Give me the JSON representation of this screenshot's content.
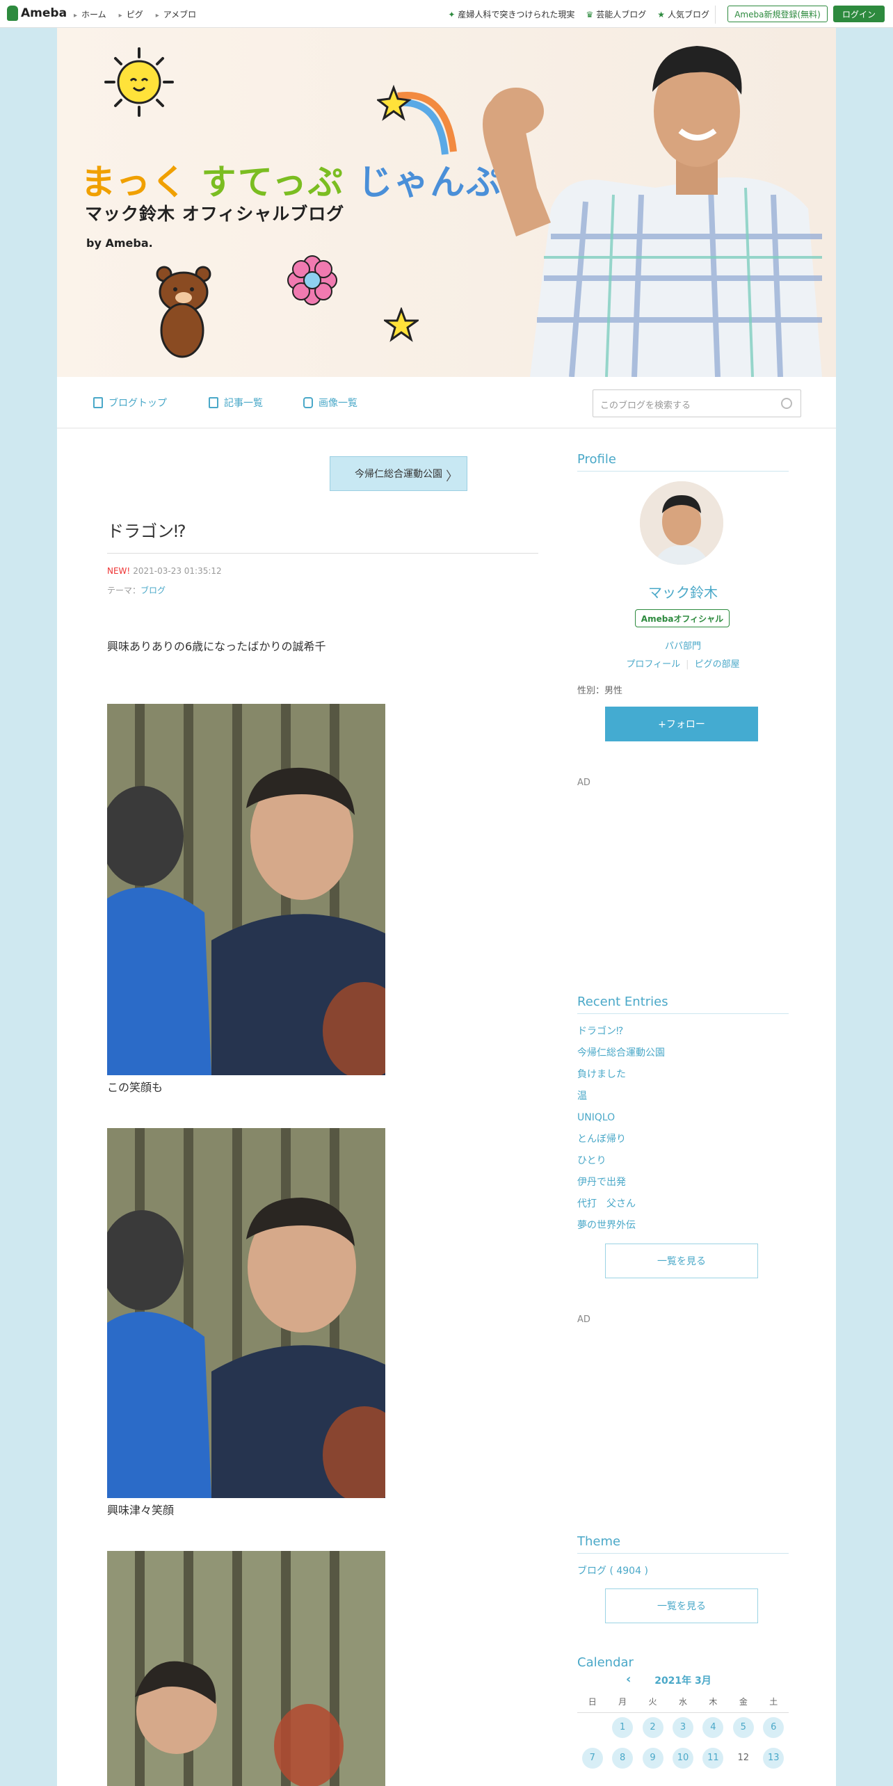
{
  "topbar": {
    "logo": "Ameba",
    "nav": [
      "ホーム",
      "ピグ",
      "アメブロ"
    ],
    "links": [
      "産婦人科で突きつけられた現実",
      "芸能人ブログ",
      "人気ブログ"
    ],
    "register": "Ameba新規登録(無料)",
    "login": "ログイン"
  },
  "header": {
    "title_a": "まっく",
    "title_b": "すてっぷ",
    "title_c": "じゃんぷ",
    "subtitle": "マック鈴木 オフィシャルブログ",
    "by": "by Ameba."
  },
  "subnav": {
    "items": [
      "ブログトップ",
      "記事一覧",
      "画像一覧"
    ],
    "search_placeholder": "このブログを検索する"
  },
  "article": {
    "prev_label": "今帰仁総合運動公園",
    "title": "ドラゴン⁉︎",
    "new_label": "NEW!",
    "date": "2021-03-23 01:35:12",
    "theme_label": "テーマ：",
    "theme": "ブログ",
    "body1": "興味ありありの6歳になったばかりの誠希千",
    "caption1": "この笑顔も",
    "caption2": "興味津々笑顔"
  },
  "profile": {
    "heading": "Profile",
    "name": "マック鈴木",
    "badge": "Amebaオフィシャル",
    "category": "パパ部門",
    "link1": "プロフィール",
    "link2": "ピグの部屋",
    "sex": "性別：男性",
    "follow": "+フォロー"
  },
  "ad_label": "AD",
  "recent": {
    "heading": "Recent Entries",
    "items": [
      "ドラゴン⁉︎",
      "今帰仁総合運動公園",
      "負けました",
      "温",
      "UNIQLO",
      "とんぼ帰り",
      "ひとり",
      "伊丹で出発",
      "代打　父さん",
      "夢の世界外伝"
    ],
    "see_all": "一覧を見る"
  },
  "theme_box": {
    "heading": "Theme",
    "item": "ブログ ( 4904 )",
    "see_all": "一覧を見る"
  },
  "calendar": {
    "heading": "Calendar",
    "month": "2021年 3月",
    "weekdays": [
      "日",
      "月",
      "火",
      "水",
      "木",
      "金",
      "土"
    ],
    "row1": [
      "",
      "1",
      "2",
      "3",
      "4",
      "5",
      "6"
    ],
    "row2": [
      "7",
      "8",
      "9",
      "10",
      "11",
      "12",
      "13"
    ]
  }
}
